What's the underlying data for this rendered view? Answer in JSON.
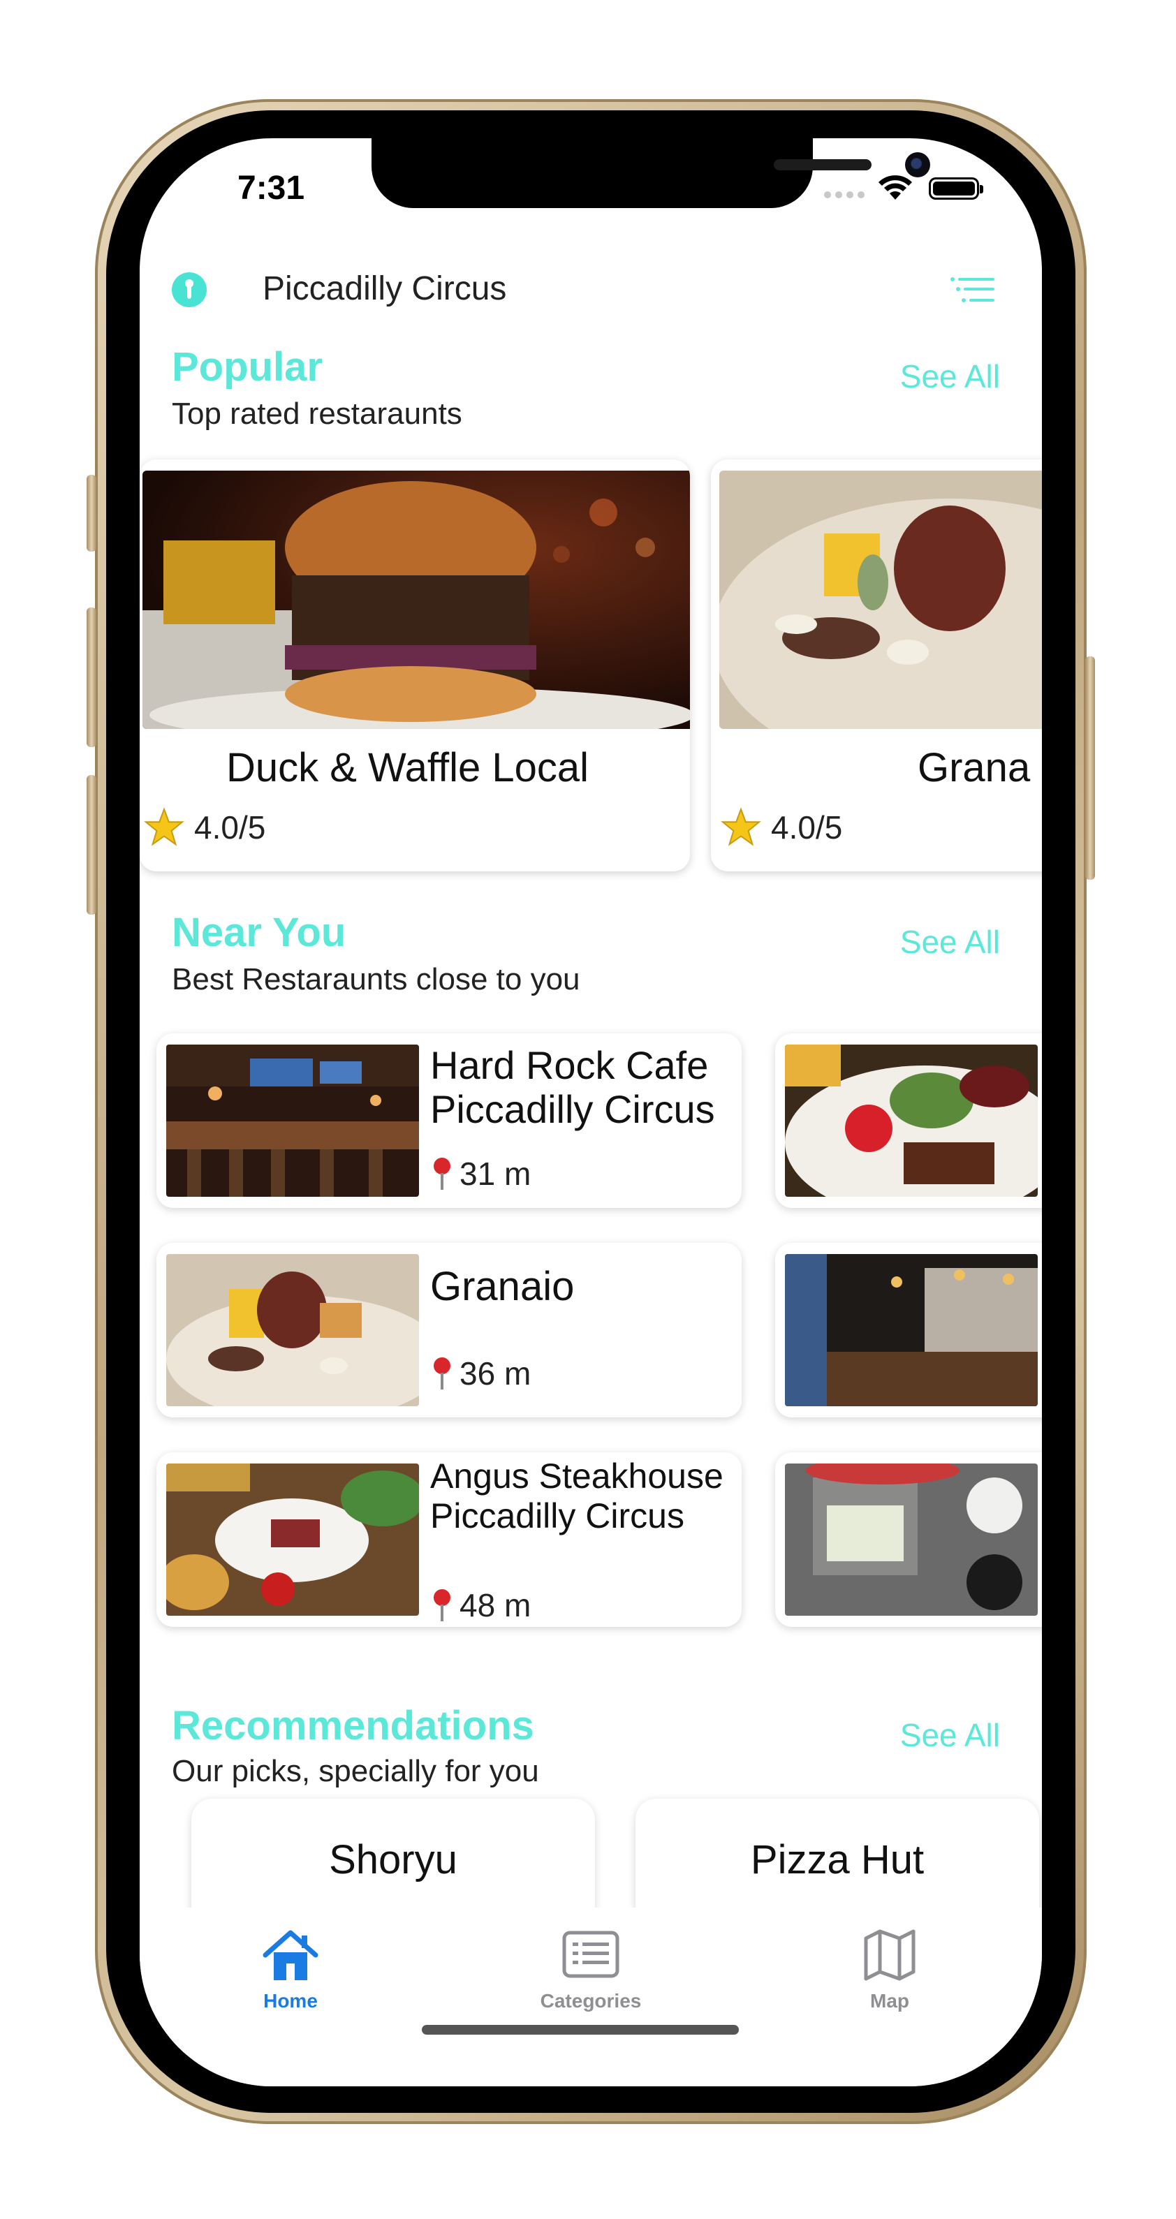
{
  "status_bar": {
    "time": "7:31"
  },
  "header": {
    "location": "Piccadilly Circus"
  },
  "sections": {
    "popular": {
      "title": "Popular",
      "subtitle": "Top rated restaraunts",
      "see_all": "See All"
    },
    "near_you": {
      "title": "Near You",
      "subtitle": "Best Restaraunts close to you",
      "see_all": "See All"
    },
    "recommendations": {
      "title": "Recommendations",
      "subtitle": "Our picks, specially for you",
      "see_all": "See All"
    }
  },
  "popular_items": [
    {
      "name": "Duck & Waffle Local",
      "rating": "4.0/5"
    },
    {
      "name": "Grana",
      "rating": "4.0/5"
    }
  ],
  "near_items": [
    {
      "name": "Hard Rock Cafe Piccadilly Circus",
      "distance": "31 m"
    },
    {
      "name": "Granaio",
      "distance": "36 m"
    },
    {
      "name": "Angus Steakhouse Piccadilly Circus",
      "distance": "48 m"
    }
  ],
  "recommended_items": [
    {
      "name": "Shoryu"
    },
    {
      "name": "Pizza Hut"
    }
  ],
  "tabbar": {
    "home": "Home",
    "categories": "Categories",
    "map": "Map"
  },
  "colors": {
    "accent": "#5ce8d8",
    "tab_active": "#1a7be3",
    "tab_inactive": "#8e8e93"
  }
}
